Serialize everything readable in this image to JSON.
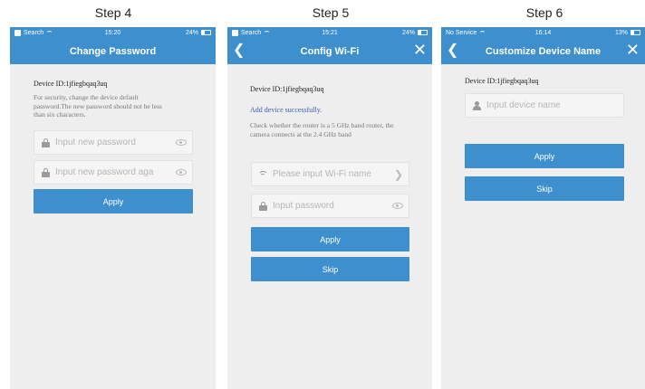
{
  "steps": [
    {
      "step_label": "Step 4",
      "status": {
        "left": "Search",
        "time": "15:20",
        "battery": "24%"
      },
      "nav_title": "Change Password",
      "device_id": "Device ID:1jfiegbqaq3uq",
      "hint": "For security, change the device default password.The new password should not be less than six characters.",
      "fields": [
        {
          "placeholder": "Input new password"
        },
        {
          "placeholder": "Input new password aga"
        }
      ],
      "apply_label": "Apply"
    },
    {
      "step_label": "Step 5",
      "status": {
        "left": "Search",
        "time": "15:21",
        "battery": "24%"
      },
      "nav_title": "Config Wi-Fi",
      "device_id": "Device ID:1jfiegbqaq3uq",
      "success": "Add device successfully.",
      "hint": "Check whether the router is a 5 GHz band router,  the camera connects at the 2.4 GHz band",
      "fields": [
        {
          "placeholder": "Please input Wi-Fi name"
        },
        {
          "placeholder": "Input password"
        }
      ],
      "apply_label": "Apply",
      "skip_label": "Skip"
    },
    {
      "step_label": "Step 6",
      "status": {
        "left": "No Service",
        "time": "16:14",
        "battery": "13%"
      },
      "nav_title": "Customize Device Name",
      "device_id": "Device ID:1jfiegbqaq3uq",
      "fields": [
        {
          "placeholder": "Input device name"
        }
      ],
      "apply_label": "Apply",
      "skip_label": "Skip"
    }
  ],
  "colors": {
    "accent": "#3d8fce",
    "screen_bg": "#eeeeef"
  },
  "icons": [
    "lock-icon",
    "eye-icon",
    "wifi-icon",
    "chevron-right-icon",
    "person-icon",
    "back-arrow-icon",
    "close-icon"
  ]
}
